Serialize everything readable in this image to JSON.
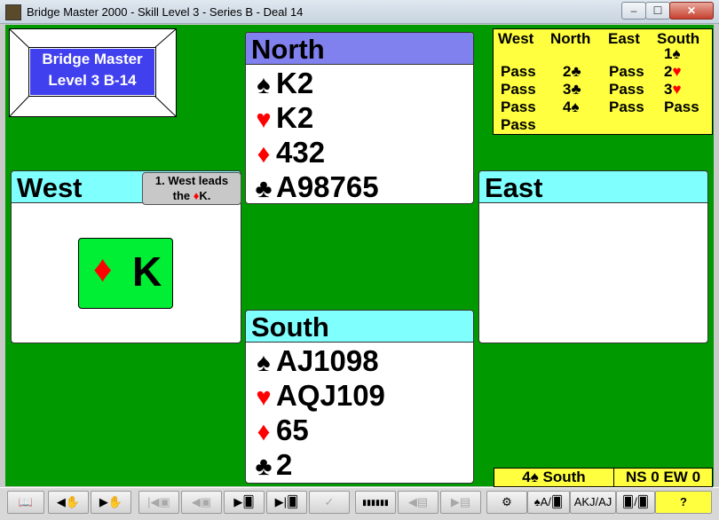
{
  "window": {
    "title": "Bridge Master 2000 - Skill Level 3 - Series B - Deal 14",
    "minimize": "–",
    "maximize": "☐",
    "close": "✕"
  },
  "logo": {
    "line1": "Bridge Master",
    "line2": "Level 3 B-14"
  },
  "north": {
    "label": "North",
    "spades": "K2",
    "hearts": "K2",
    "diamonds": "432",
    "clubs": "A98765"
  },
  "south": {
    "label": "South",
    "spades": "AJ1098",
    "hearts": "AQJ109",
    "diamonds": "65",
    "clubs": "2"
  },
  "west": {
    "label": "West",
    "note_line1": "1. West leads",
    "note_line2_prefix": "the ",
    "note_line2_suit": "♦",
    "note_line2_rank": "K."
  },
  "east": {
    "label": "East"
  },
  "played_card": {
    "suit": "♦",
    "rank": "K"
  },
  "bidding": {
    "headers": [
      "West",
      "North",
      "East",
      "South"
    ],
    "bids": [
      {
        "text": "1",
        "suit": "♠",
        "suit_color": "#000000"
      },
      {
        "text": "Pass"
      },
      {
        "text": "2",
        "suit": "♣",
        "suit_color": "#000000"
      },
      {
        "text": "Pass"
      },
      {
        "text": "2",
        "suit": "♥",
        "suit_color": "#ff0000"
      },
      {
        "text": "Pass"
      },
      {
        "text": "3",
        "suit": "♣",
        "suit_color": "#000000"
      },
      {
        "text": "Pass"
      },
      {
        "text": "3",
        "suit": "♥",
        "suit_color": "#ff0000"
      },
      {
        "text": "Pass"
      },
      {
        "text": "4",
        "suit": "♠",
        "suit_color": "#000000"
      },
      {
        "text": "Pass"
      },
      {
        "text": "Pass"
      },
      {
        "text": "Pass"
      }
    ]
  },
  "contract": {
    "level": "4",
    "suit": "♠",
    "declarer": "South",
    "score": "NS 0 EW 0"
  },
  "toolbar": {
    "book": "📖",
    "back_hand": "◀✋",
    "fwd_hand": "▶✋",
    "first_trick": "|◀▣",
    "prev_trick": "◀▣",
    "next_trick": "▶🂠",
    "last_trick": "▶|🂠",
    "check": "✓",
    "keyboard": "▮▮▮▮▮▮",
    "prev_page": "◀▤",
    "next_page": "▶▤",
    "settings": "⚙",
    "spade_a": "♠A/🂠",
    "akj": "AKJ/AJ",
    "cards_toggle": "🂠/🂠",
    "help": "?"
  },
  "colors": {
    "table": "#009900",
    "north_head": "#8080ee",
    "cyan_head": "#80ffff",
    "bidding_bg": "#ffff40",
    "played_card": "#00ee33"
  }
}
